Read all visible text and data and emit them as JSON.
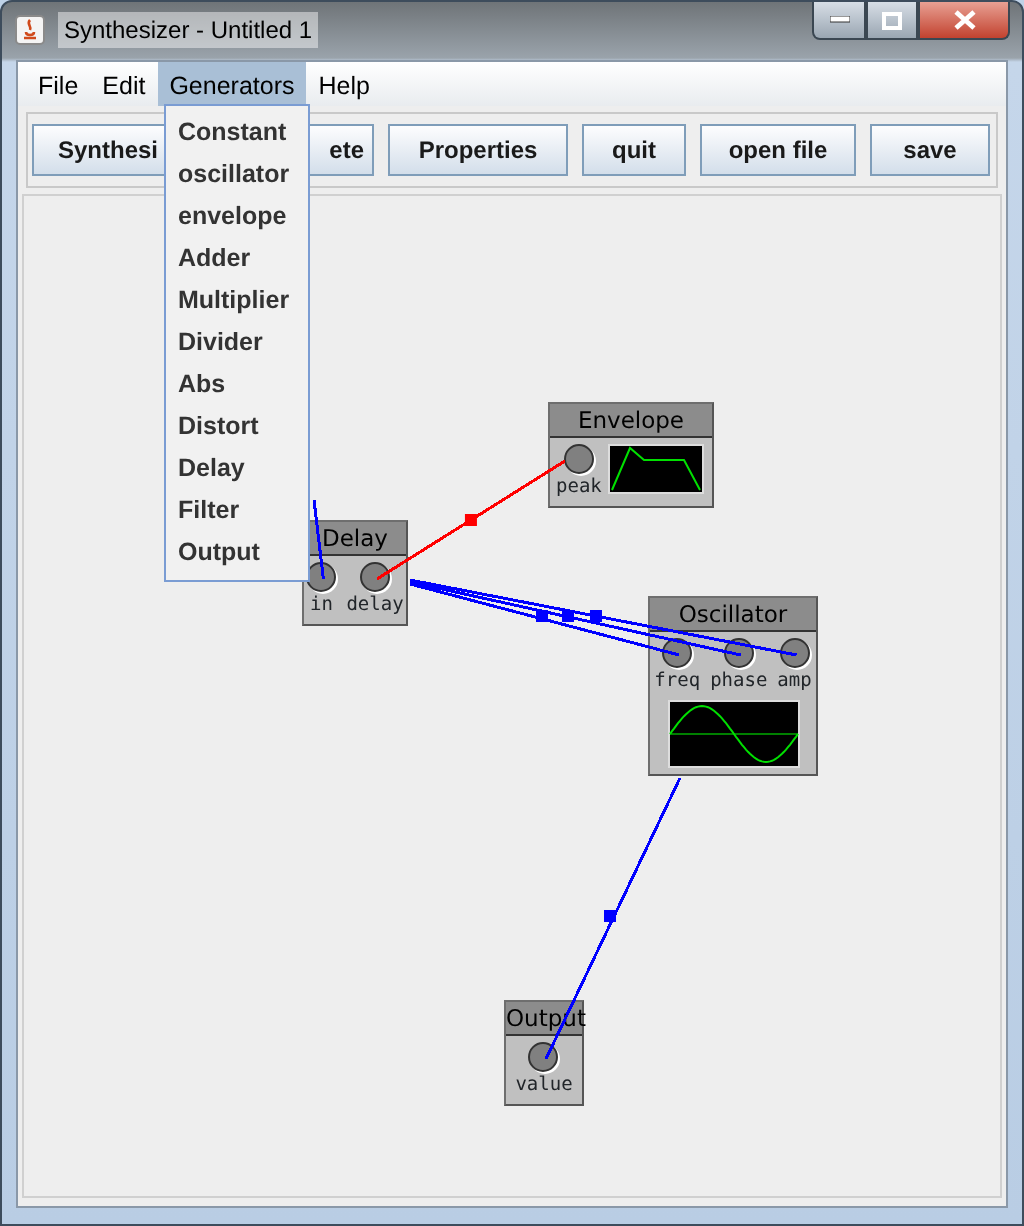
{
  "window": {
    "title": "Synthesizer - Untitled 1"
  },
  "menubar": [
    {
      "label": "File",
      "selected": false
    },
    {
      "label": "Edit",
      "selected": false
    },
    {
      "label": "Generators",
      "selected": true
    },
    {
      "label": "Help",
      "selected": false
    }
  ],
  "toolbar": [
    "Synthesi",
    "ete",
    "Properties",
    "quit",
    "open file",
    "save"
  ],
  "open_menu": [
    "Constant",
    "oscillator",
    "envelope",
    "Adder",
    "Multiplier",
    "Divider",
    "Abs",
    "Distort",
    "Delay",
    "Filter",
    "Output"
  ],
  "nodes": [
    {
      "title": "Envelope",
      "kind": "envelope",
      "ports": [
        "peak"
      ]
    },
    {
      "title": "Delay",
      "kind": "plain",
      "ports": [
        "in",
        "delay"
      ]
    },
    {
      "title": "Oscillator",
      "kind": "oscillator",
      "ports": [
        "freq",
        "phase",
        "amp"
      ]
    },
    {
      "title": "Output",
      "kind": "plain",
      "ports": [
        "value"
      ]
    }
  ],
  "wires": [
    {
      "color": "#0000ff"
    },
    {
      "color": "#ff0000"
    },
    {
      "color": "#0000ff"
    },
    {
      "color": "#0000ff"
    },
    {
      "color": "#0000ff"
    },
    {
      "color": "#0000ff"
    }
  ]
}
